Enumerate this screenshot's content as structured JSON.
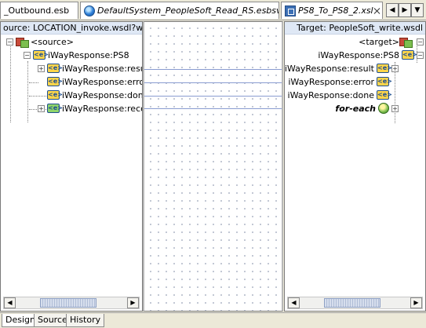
{
  "tabs": [
    {
      "label": "_Outbound.esb"
    },
    {
      "label": "DefaultSystem_PeopleSoft_Read_RS.esbsvc"
    },
    {
      "label": "PS8_To_PS8_2.xsl"
    }
  ],
  "nav": {
    "left": "◀",
    "right": "▶",
    "menu": "▼"
  },
  "left_panel": {
    "header": "ource: LOCATION_invoke.wsdl?wsdl",
    "root": "<source>",
    "child": "iWayResponse:PS8",
    "items": [
      {
        "label": "iWayResponse:resu"
      },
      {
        "label": "iWayResponse:erro"
      },
      {
        "label": "iWayResponse:don"
      },
      {
        "label": "iWayResponse:reco"
      }
    ]
  },
  "right_panel": {
    "header": "Target: PeopleSoft_write.wsdl",
    "root": "<target>",
    "child": "iWayResponse:PS8",
    "items": [
      {
        "label": "iWayResponse:result"
      },
      {
        "label": "iWayResponse:error"
      },
      {
        "label": "iWayResponse:done"
      },
      {
        "label": "for-each"
      }
    ]
  },
  "scroll": {
    "left": "◀",
    "right": "▶"
  },
  "tree_glyphs": {
    "expand": "+",
    "collapse": "−",
    "element": "<e>"
  },
  "bottom_tabs": [
    {
      "label": "Design"
    },
    {
      "label": "Source"
    },
    {
      "label": "History"
    }
  ]
}
